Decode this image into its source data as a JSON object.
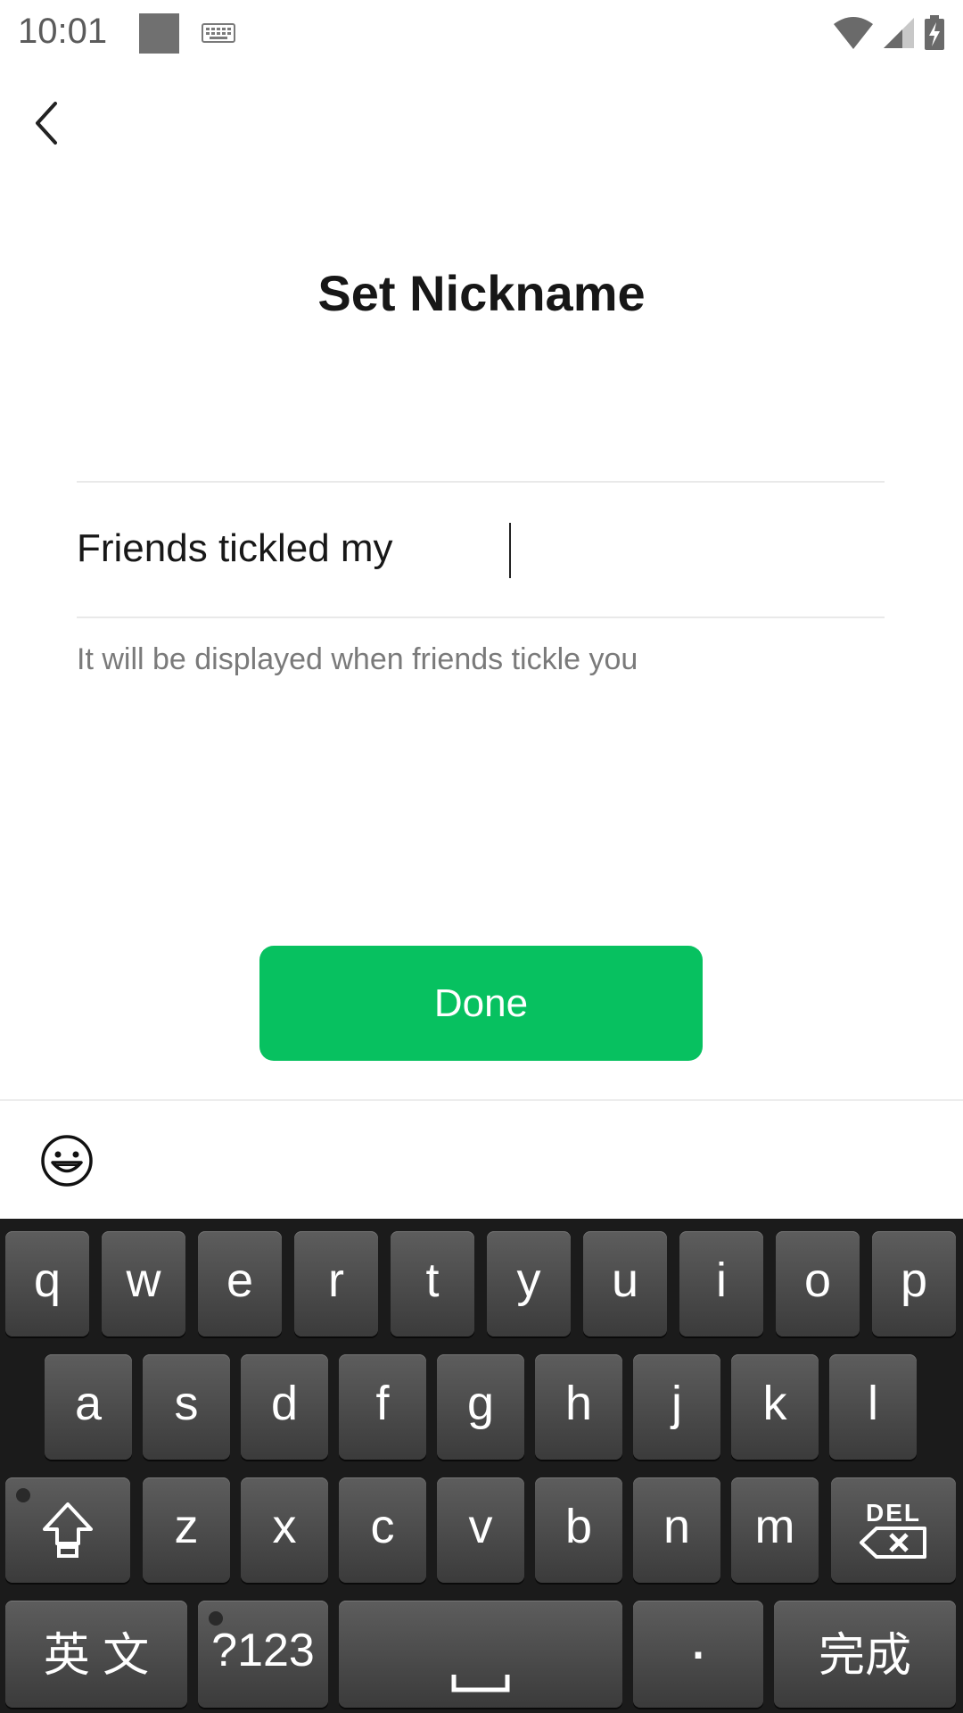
{
  "status_bar": {
    "time": "10:01",
    "icons": [
      "notification-square-icon",
      "keyboard-icon",
      "wifi-icon",
      "cell-signal-icon",
      "battery-charging-icon"
    ]
  },
  "header": {
    "back_icon": "chevron-left-icon",
    "title": "Set Nickname"
  },
  "nickname": {
    "value": "Friends tickled my",
    "hint": "It will be displayed when friends tickle you"
  },
  "actions": {
    "done_label": "Done"
  },
  "toolbar": {
    "emoji_icon": "smiley-face-icon"
  },
  "keyboard": {
    "row1": [
      "q",
      "w",
      "e",
      "r",
      "t",
      "y",
      "u",
      "i",
      "o",
      "p"
    ],
    "row2": [
      "a",
      "s",
      "d",
      "f",
      "g",
      "h",
      "j",
      "k",
      "l"
    ],
    "row3": [
      "z",
      "x",
      "c",
      "v",
      "b",
      "n",
      "m"
    ],
    "shift_icon": "shift-arrow-icon",
    "delete_label": "DEL",
    "language_label": "英 文",
    "symbols_label": "?123",
    "space_icon": "space-bar-icon",
    "period_label": "·",
    "enter_label": "完成"
  },
  "colors": {
    "accent": "#07c160",
    "keyboard_bg": "#1b1b1b",
    "key_bg": "#4a4a4a"
  }
}
